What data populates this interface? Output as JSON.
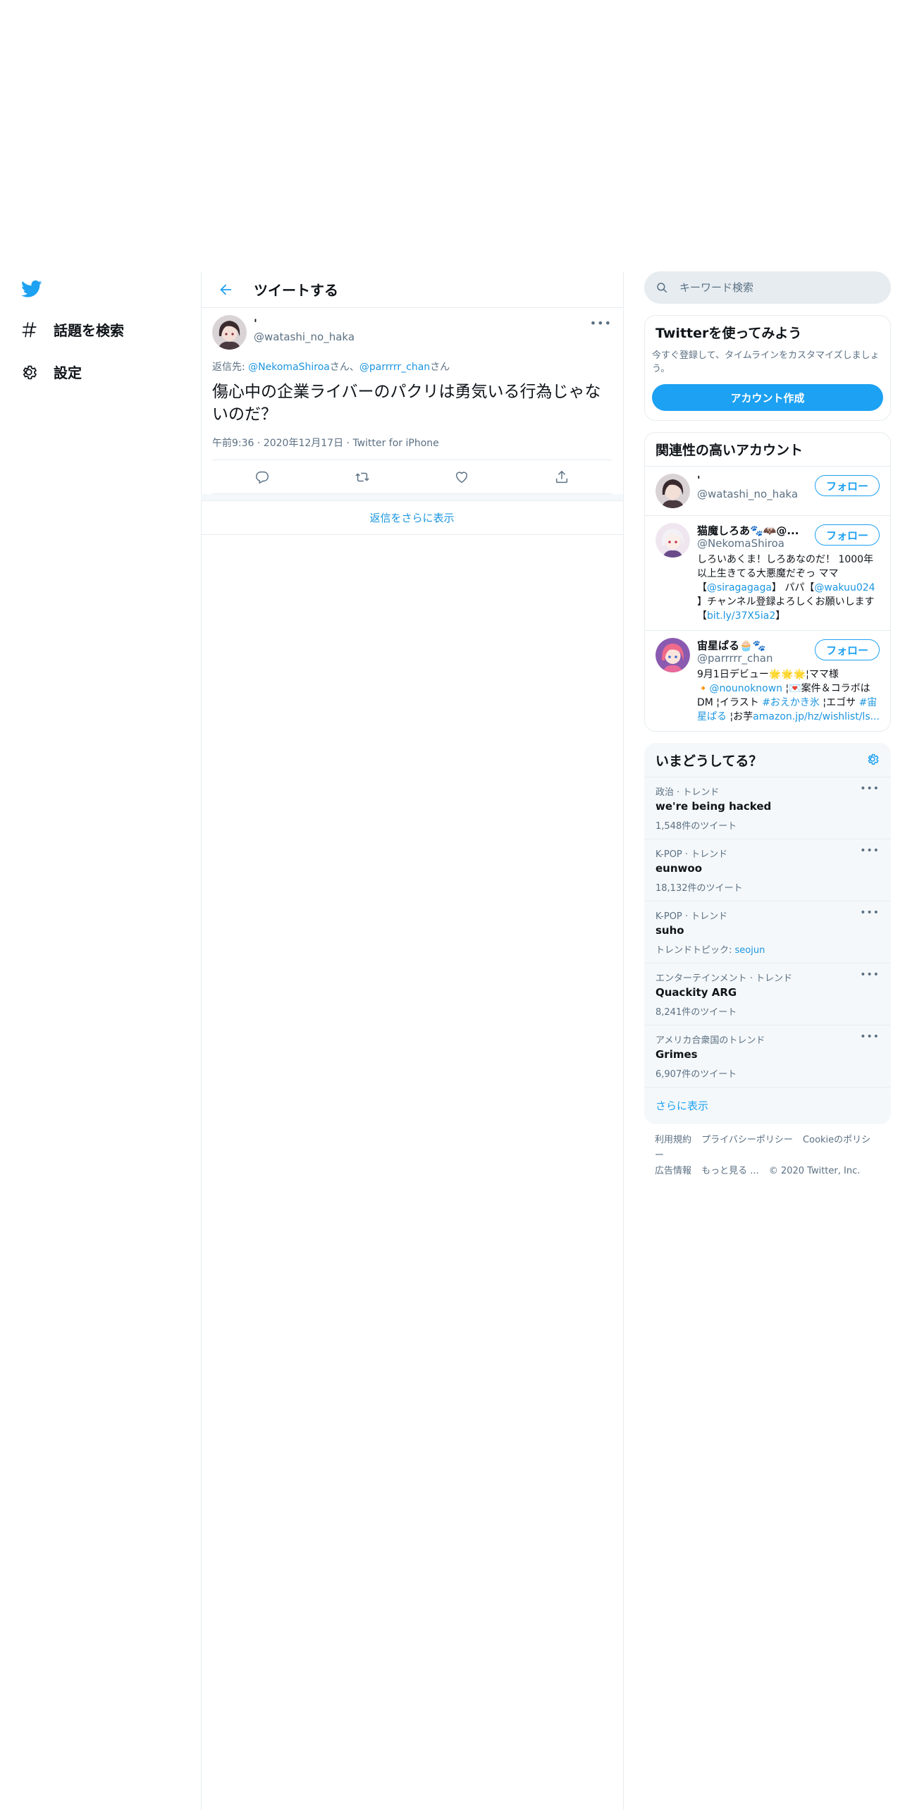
{
  "nav": {
    "explore_label": "話題を検索",
    "settings_label": "設定"
  },
  "header": {
    "title": "ツイートする"
  },
  "tweet": {
    "display_name": "'",
    "handle": "@watashi_no_haka",
    "more": "•••",
    "reply_prefix": "返信先: ",
    "reply_user1": "@NekomaShiroa",
    "reply_suffix1": "さん、",
    "reply_user2": "@parrrrr_chan",
    "reply_suffix2": "さん",
    "text": "傷心中の企業ライバーのパクリは勇気いる行為じゃないのだ？",
    "time": "午前9:36",
    "sep": " · ",
    "date": "2020年12月17日",
    "source": "Twitter for iPhone"
  },
  "show_replies": "返信をさらに表示",
  "search": {
    "placeholder": "キーワード検索"
  },
  "signup": {
    "title": "Twitterを使ってみよう",
    "desc": "今すぐ登録して、タイムラインをカスタマイズしましょう。",
    "button": "アカウント作成"
  },
  "relevant": {
    "title": "関連性の高いアカウント",
    "follow_label": "フォロー",
    "accounts": [
      {
        "name": "'",
        "handle": "@watashi_no_haka"
      },
      {
        "name": "猫魔しろあ🐾🦇@...",
        "handle": "@NekomaShiroa",
        "bio1": "しろいあくま！しろあなのだ！ 1000年以上生きてる大悪魔だぞっ ママ【",
        "bio_link1": "@siragagaga",
        "bio2": "】 パパ【",
        "bio_link2": "@wakuu024",
        "bio3": " 】チャンネル登録よろしくお願いします【",
        "bio_link3": "bit.ly/37X5ia2",
        "bio4": "】"
      },
      {
        "name": "宙星ぱる🧁🐾",
        "handle": "@parrrrr_chan",
        "bio1": "9月1日デビュー🌟🌟🌟¦ママ様🔸",
        "bio_link1": "@nounoknown",
        "bio2": " ¦💌案件＆コラボはDM ¦イラスト ",
        "bio_link2": "#おえかき氷",
        "bio3": " ¦エゴサ ",
        "bio_link3": "#宙星ぱる",
        "bio4": " ¦お芋",
        "bio_link4": "amazon.jp/hz/wishlist/ls..."
      }
    ]
  },
  "trends": {
    "title": "いまどうしてる？",
    "more": "•••",
    "items": [
      {
        "category": "政治 · トレンド",
        "name": "we're being hacked",
        "count": "1,548件のツイート"
      },
      {
        "category": "K-POP · トレンド",
        "name": "eunwoo",
        "count": "18,132件のツイート"
      },
      {
        "category": "K-POP · トレンド",
        "name": "suho",
        "count_prefix": "トレンドトピック: ",
        "count_link": "seojun"
      },
      {
        "category": "エンターテインメント · トレンド",
        "name": "Quackity ARG",
        "count": "8,241件のツイート"
      },
      {
        "category": "アメリカ合衆国のトレンド",
        "name": "Grimes",
        "count": "6,907件のツイート"
      }
    ],
    "show_more": "さらに表示"
  },
  "footer": {
    "terms": "利用規約",
    "privacy": "プライバシーポリシー",
    "cookie": "Cookieのポリシー",
    "ads": "広告情報",
    "more": "もっと見る ...",
    "copyright": "© 2020 Twitter, Inc."
  },
  "colors": {
    "accent": "#1da1f2",
    "link": "#1b95e0",
    "muted": "#5b7083",
    "border": "#e6ecf0"
  }
}
